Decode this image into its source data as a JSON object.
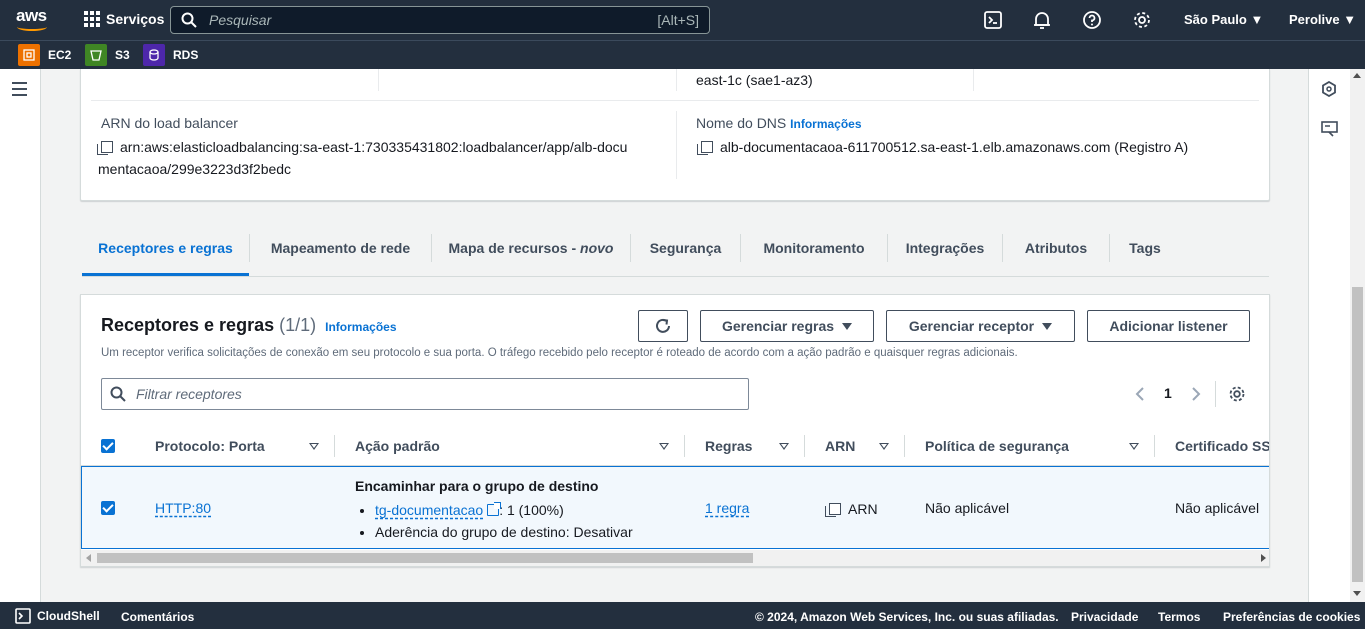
{
  "topnav": {
    "logo": "aws",
    "services_label": "Serviços",
    "search_placeholder": "Pesquisar",
    "search_shortcut": "[Alt+S]",
    "region": "São Paulo",
    "account": "Perolive",
    "icons": [
      "cloudshell-icon",
      "bell-icon",
      "help-icon",
      "gear-icon"
    ]
  },
  "favorites": [
    {
      "label": "EC2",
      "color": "#ed7100"
    },
    {
      "label": "S3",
      "color": "#3f8624"
    },
    {
      "label": "RDS",
      "color": "#4d27aa"
    }
  ],
  "details": {
    "az_value": "east-1c (sae1-az3)",
    "arn_label": "ARN do load balancer",
    "arn_value_line1": "arn:aws:elasticloadbalancing:sa-east-1:730335431802:loadbalancer/app/alb-docu",
    "arn_value_line2": "mentacaoa/299e3223d3f2bedc",
    "dns_label": "Nome do DNS",
    "dns_info": "Informações",
    "dns_value": "alb-documentacaoa-611700512.sa-east-1.elb.amazonaws.com (Registro A)"
  },
  "tabs": [
    {
      "label": "Receptores e regras",
      "active": true
    },
    {
      "label": "Mapeamento de rede"
    },
    {
      "label": "Mapa de recursos - ",
      "suffix": "novo"
    },
    {
      "label": "Segurança"
    },
    {
      "label": "Monitoramento"
    },
    {
      "label": "Integrações"
    },
    {
      "label": "Atributos"
    },
    {
      "label": "Tags"
    }
  ],
  "listeners": {
    "title": "Receptores e regras",
    "count": "(1/1)",
    "info": "Informações",
    "description": "Um receptor verifica solicitações de conexão em seu protocolo e sua porta. O tráfego recebido pelo receptor é roteado de acordo com a ação padrão e quaisquer regras adicionais.",
    "buttons": {
      "manage_rules": "Gerenciar regras",
      "manage_listener": "Gerenciar receptor",
      "add_listener": "Adicionar listener"
    },
    "filter_placeholder": "Filtrar receptores",
    "page": "1",
    "columns": [
      "Protocolo: Porta",
      "Ação padrão",
      "Regras",
      "ARN",
      "Política de segurança",
      "Certificado SSL"
    ],
    "rows": [
      {
        "protocol_port": "HTTP:80",
        "action_title": "Encaminhar para o grupo de destino",
        "target_group": "tg-documentacao",
        "target_weight": ": 1 (100%)",
        "stickiness": "Aderência do grupo de destino: Desativar",
        "rules": "1 regra",
        "arn": "ARN",
        "policy": "Não aplicável",
        "certificate": "Não aplicável"
      }
    ]
  },
  "footer": {
    "cloudshell": "CloudShell",
    "feedback": "Comentários",
    "copyright": "© 2024, Amazon Web Services, Inc. ou suas afiliadas.",
    "privacy": "Privacidade",
    "terms": "Termos",
    "cookies": "Preferências de cookies"
  }
}
